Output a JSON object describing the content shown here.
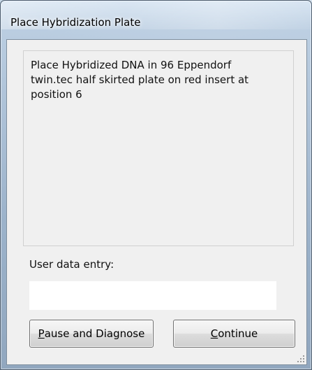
{
  "window": {
    "title": "Place Hybridization Plate"
  },
  "message": {
    "text": "Place Hybridized DNA in 96 Eppendorf twin.tec half skirted plate on red insert at position 6"
  },
  "entry": {
    "label": "User data entry:",
    "value": ""
  },
  "buttons": {
    "pause": {
      "mnemonic": "P",
      "rest": "ause and Diagnose"
    },
    "continue": {
      "mnemonic": "C",
      "rest": "ontinue"
    }
  },
  "colors": {
    "client_background": "#f0f0f0",
    "input_background": "#ffffff",
    "title_glass": "#b9cde1"
  }
}
